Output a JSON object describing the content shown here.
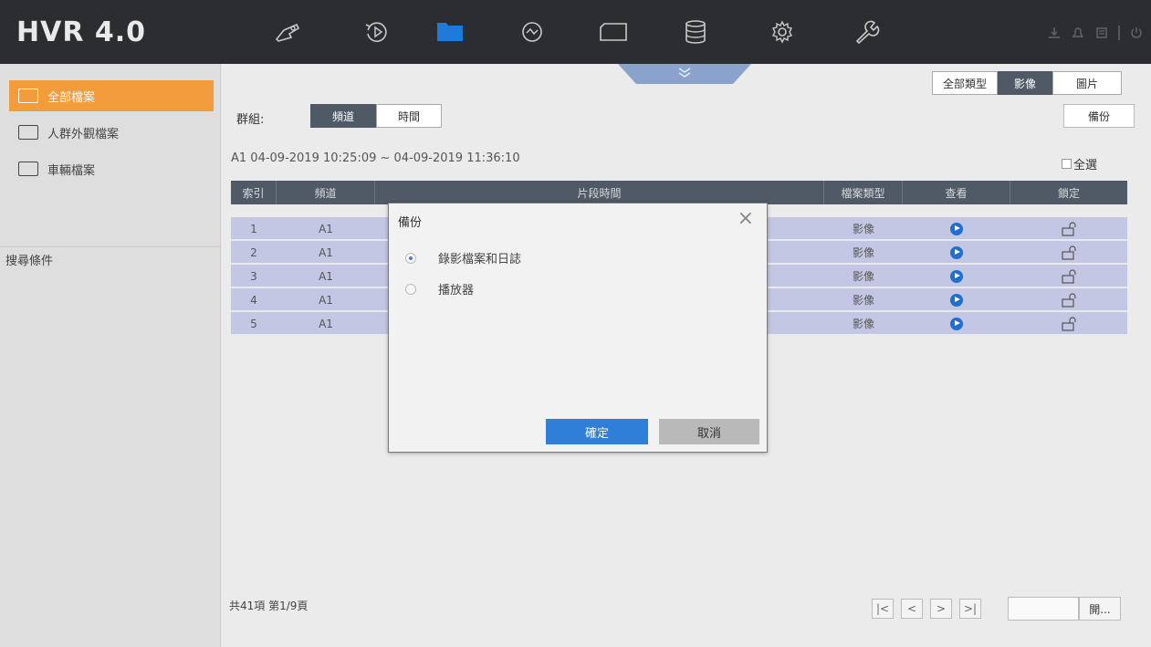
{
  "app": {
    "logo": "HVR 4.0"
  },
  "nav": {
    "icons": [
      "live-view-icon",
      "playback-icon",
      "file-management-icon",
      "smart-analysis-icon",
      "display-icon",
      "storage-icon",
      "settings-icon",
      "maintenance-icon"
    ],
    "active_index": 2,
    "right_icons": [
      "download-icon",
      "alarm-icon",
      "task-icon",
      "power-icon"
    ]
  },
  "sidebar": {
    "items": [
      {
        "label": "全部檔案",
        "active": true
      },
      {
        "label": "人群外觀檔案",
        "active": false
      },
      {
        "label": "車輛檔案",
        "active": false
      }
    ],
    "section_label": "搜尋條件"
  },
  "filter": {
    "group_label": "群組:",
    "group_options": [
      "頻道",
      "時間"
    ],
    "group_selected": "頻道",
    "type_options": [
      "全部類型",
      "影像",
      "圖片"
    ],
    "type_selected": "影像",
    "backup_label": "備份",
    "range": "A1 04-09-2019 10:25:09 ~ 04-09-2019 11:36:10",
    "select_all": "全選"
  },
  "table": {
    "headers": [
      "索引",
      "頻道",
      "片段時間",
      "檔案類型",
      "查看",
      "鎖定"
    ],
    "rows": [
      {
        "index": "1",
        "channel": "A1",
        "type": "影像"
      },
      {
        "index": "2",
        "channel": "A1",
        "type": "影像"
      },
      {
        "index": "3",
        "channel": "A1",
        "type": "影像"
      },
      {
        "index": "4",
        "channel": "A1",
        "type": "影像"
      },
      {
        "index": "5",
        "channel": "A1",
        "type": "影像"
      }
    ]
  },
  "dialog": {
    "title": "備份",
    "options": [
      "錄影檔案和日誌",
      "播放器"
    ],
    "selected_index": 0,
    "ok_label": "確定",
    "cancel_label": "取消"
  },
  "footer": {
    "summary": "共41項 第1/9頁",
    "pager": [
      "|<",
      "<",
      ">",
      ">|"
    ],
    "go_label": "開..."
  },
  "colors": {
    "accent_orange": "#f39c3b",
    "header_dark": "#4f5a66",
    "row_purple": "#c4c7e4",
    "ok_blue": "#2f7ed8",
    "active_nav_blue": "#1e7ad8"
  }
}
